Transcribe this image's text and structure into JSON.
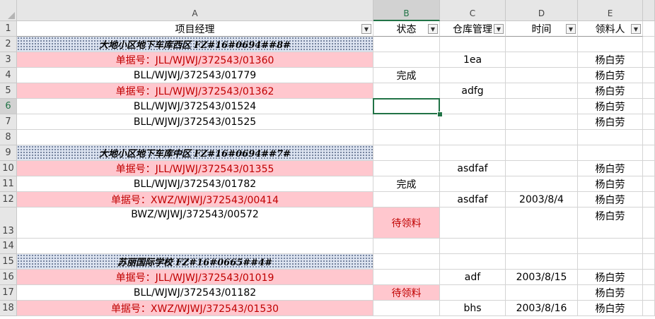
{
  "columns": [
    {
      "id": "A",
      "label": "A",
      "header": "项目经理"
    },
    {
      "id": "B",
      "label": "B",
      "header": "状态"
    },
    {
      "id": "C",
      "label": "C",
      "header": "仓库管理"
    },
    {
      "id": "D",
      "label": "D",
      "header": "时间"
    },
    {
      "id": "E",
      "label": "E",
      "header": "领料人"
    }
  ],
  "rows": [
    {
      "n": "1",
      "type": "header"
    },
    {
      "n": "2",
      "type": "group",
      "A": "大地小区地下车库西区   FZ#16#0694##8#"
    },
    {
      "n": "3",
      "type": "doc",
      "A": "单据号：JLL/WJWJ/372543/01360",
      "C": "1ea",
      "E": "杨白劳"
    },
    {
      "n": "4",
      "type": "item",
      "A": "BLL/WJWJ/372543/01779",
      "B": "完成",
      "E": "杨白劳"
    },
    {
      "n": "5",
      "type": "doc",
      "A": "单据号：JLL/WJWJ/372543/01362",
      "C": "adfg",
      "E": "杨白劳"
    },
    {
      "n": "6",
      "type": "item",
      "A": "BLL/WJWJ/372543/01524",
      "E": "杨白劳"
    },
    {
      "n": "7",
      "type": "item",
      "A": "BLL/WJWJ/372543/01525",
      "E": "杨白劳"
    },
    {
      "n": "8",
      "type": "blank"
    },
    {
      "n": "9",
      "type": "group",
      "A": "大地小区地下车库中区   FZ#16#0694##7#"
    },
    {
      "n": "10",
      "type": "doc",
      "A": "单据号：JLL/WJWJ/372543/01355",
      "C": "asdfaf",
      "E": "杨白劳"
    },
    {
      "n": "11",
      "type": "item",
      "A": "BLL/WJWJ/372543/01782",
      "B": "完成",
      "E": "杨白劳"
    },
    {
      "n": "12",
      "type": "doc",
      "A": "单据号：XWZ/WJWJ/372543/00414",
      "C": "asdfaf",
      "D": "2003/8/4",
      "E": "杨白劳"
    },
    {
      "n": "13",
      "type": "item-tall",
      "A": "BWZ/WJWJ/372543/00572",
      "B": "待领料",
      "B_pink": true,
      "E": "杨白劳"
    },
    {
      "n": "14",
      "type": "blank"
    },
    {
      "n": "15",
      "type": "group",
      "A": "苏丽国际学校   FZ#16#0665##4#"
    },
    {
      "n": "16",
      "type": "doc",
      "A": "单据号：JLL/WJWJ/372543/01019",
      "C": "adf",
      "D": "2003/8/15",
      "E": "杨白劳"
    },
    {
      "n": "17",
      "type": "item",
      "A": "BLL/WJWJ/372543/01182",
      "B": "待领料",
      "B_pink": true,
      "E": "杨白劳"
    },
    {
      "n": "18",
      "type": "doc",
      "A": "单据号：XWZ/WJWJ/372543/01530",
      "C": "bhs",
      "D": "2003/8/16",
      "E": "杨白劳"
    }
  ],
  "selection": {
    "active_cell": "B6",
    "selected_column": "B",
    "selected_row": "6"
  },
  "colors": {
    "pink_fill": "#ffc7ce",
    "pink_text": "#c00000",
    "selection_green": "#217346",
    "group_fill": "#dce3f0"
  }
}
